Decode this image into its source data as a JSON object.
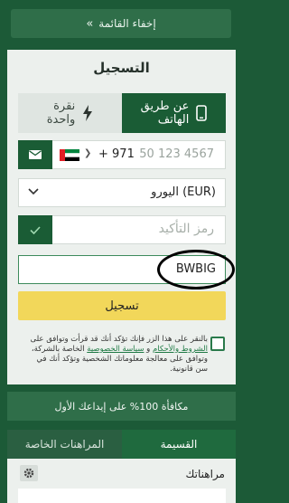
{
  "menu": {
    "hide_label": "إخفاء القائمة",
    "chevron": "»"
  },
  "registration": {
    "title": "التسجيل",
    "tabs": [
      {
        "label_line1": "عن طريق",
        "label_line2": "الهاتف",
        "icon": "phone-icon",
        "active": true
      },
      {
        "label_line1": "نقرة",
        "label_line2": "واحدة",
        "icon": "lightning-icon",
        "active": false
      }
    ],
    "phone": {
      "country": "UAE",
      "dial_code": "+ 971",
      "placeholder": "50 123 4567"
    },
    "currency": {
      "value": "اليورو (EUR)"
    },
    "confirmation_code": {
      "placeholder": "رمز التأكيد"
    },
    "promo_code": {
      "value": "BWBIG"
    },
    "submit_label": "تسجيل",
    "terms": {
      "part1": "بالنقر على هذا الزر فإنك تؤكد أنك قد قرأت وتوافق على ",
      "link1": "الشروط والأحكام",
      "part2": " و ",
      "link2": "سياسة الخصوصية",
      "part3": " الخاصة بالشركة، وتوافق على معالجة معلوماتك الشخصية وتؤكد أنك في سن قانونية."
    }
  },
  "bonus": {
    "text": "مكافأة 100% على إيداعك الأول"
  },
  "bet_tabs": [
    {
      "label": "القسيمة",
      "active": true
    },
    {
      "label": "المراهنات الخاصة",
      "active": false
    }
  ],
  "bets": {
    "label": "مراهناتك"
  },
  "colors": {
    "primary": "#1a5c35",
    "accent": "#f2d75a",
    "background": "#1c5a37"
  }
}
